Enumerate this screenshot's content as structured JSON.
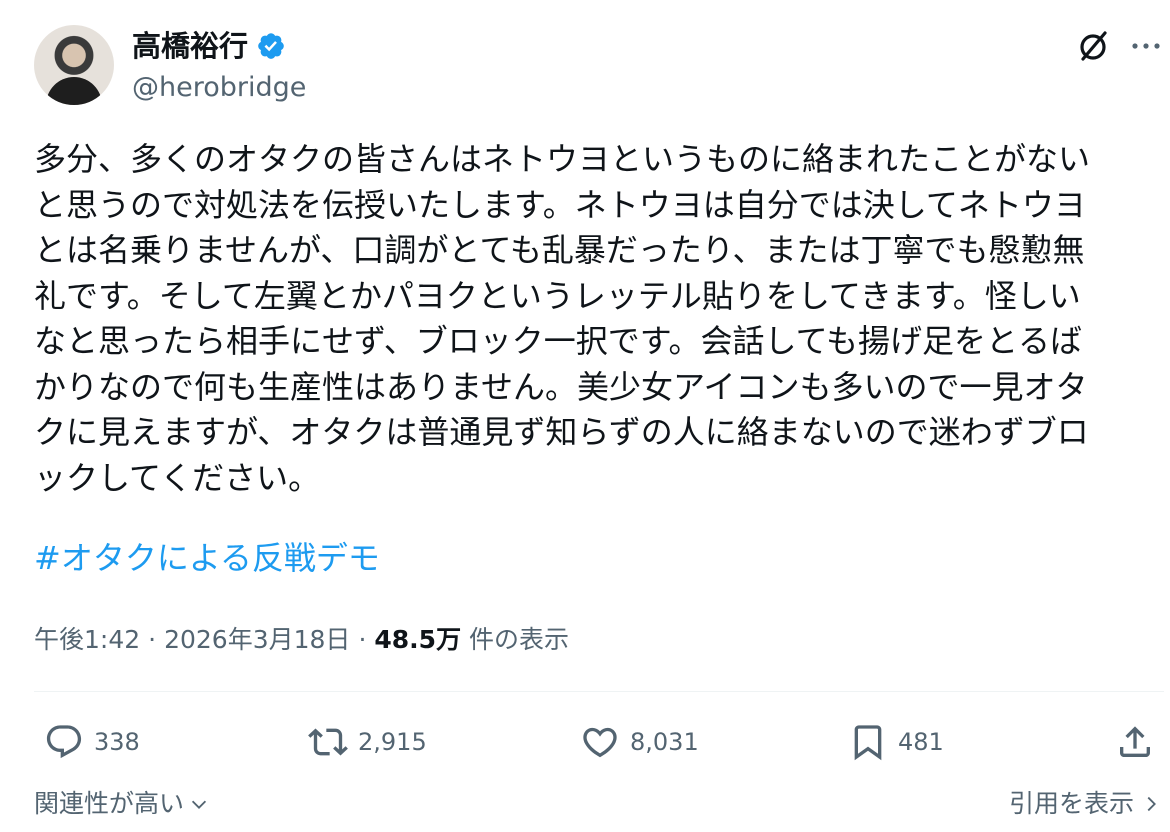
{
  "author": {
    "display_name": "高橋裕行",
    "handle": "@herobridge",
    "verified_badge_color": "#1d9bf0"
  },
  "header_icons": [
    "grok-icon",
    "more-icon"
  ],
  "tweet": {
    "text": "多分、多くのオタクの皆さんはネトウヨというものに絡まれたことがない\nと思うので対処法を伝授いたします。ネトウヨは自分では決してネトウヨ\nとは名乗りませんが、口調がとても乱暴だったり、または丁寧でも慇懃無\n礼です。そして左翼とかパヨクというレッテル貼りをしてきます。怪しい\nなと思ったら相手にせず、ブロック一択です。会話しても揚げ足をとるば\nかりなので何も生産性はありません。美少女アイコンも多いので一見オタ\nクに見えますが、オタクは普通見ず知らずの人に絡まないので迷わずブロ\nックしてください。",
    "hashtag": "#オタクによる反戦デモ",
    "hashtag_color": "#1d9bf0"
  },
  "meta": {
    "time": "午後1:42",
    "sep1": "·",
    "date": "2026年3月18日",
    "sep2": "·",
    "views_count": "48.5万",
    "views_label": "件の表示"
  },
  "actions": {
    "replies": "338",
    "reposts": "2,915",
    "likes": "8,031",
    "bookmarks": "481"
  },
  "footer": {
    "sort_label": "関連性が高い",
    "quotes_label": "引用を表示"
  },
  "colors": {
    "text": "#0f1419",
    "secondary": "#536471",
    "accent": "#1d9bf0"
  }
}
